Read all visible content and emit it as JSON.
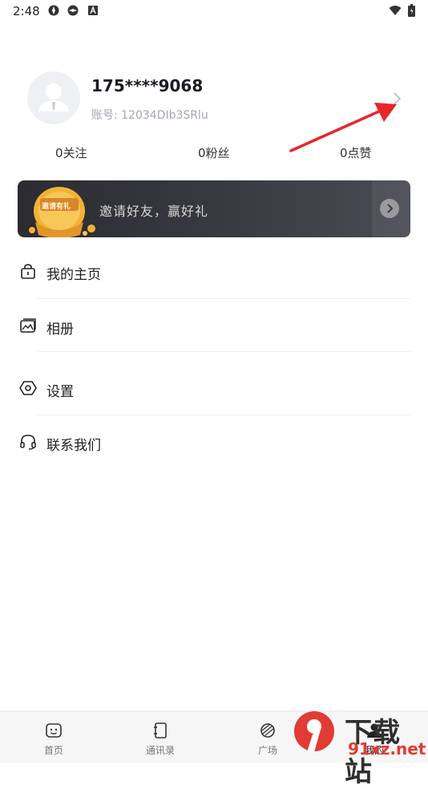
{
  "status_bar": {
    "time": "2:48"
  },
  "profile": {
    "phone": "175****9068",
    "account": "账号: 12034DIb3SRlu"
  },
  "stats": [
    {
      "label": "0关注"
    },
    {
      "label": "0粉丝"
    },
    {
      "label": "0点赞"
    }
  ],
  "banner": {
    "text": "邀请好友，赢好礼",
    "badge": "邀请有礼"
  },
  "menu": [
    {
      "label": "我的主页",
      "icon": "lock-home-icon"
    },
    {
      "label": "相册",
      "icon": "album-icon"
    },
    {
      "label": "设置",
      "icon": "settings-icon"
    },
    {
      "label": "联系我们",
      "icon": "headset-icon"
    }
  ],
  "bottom_nav": [
    {
      "label": "首页",
      "icon": "home-face-icon"
    },
    {
      "label": "通讯录",
      "icon": "contacts-book-icon"
    },
    {
      "label": "广场",
      "icon": "plaza-icon"
    },
    {
      "label": "我的",
      "icon": "person-icon",
      "active": true
    }
  ],
  "watermark": {
    "line1": "下载站",
    "line2": "91xz.net",
    "logo": "9"
  },
  "colors": {
    "annotation_arrow": "#e8262a",
    "banner_bg": "#2f2f36",
    "accent_gold": "#f1b234"
  }
}
